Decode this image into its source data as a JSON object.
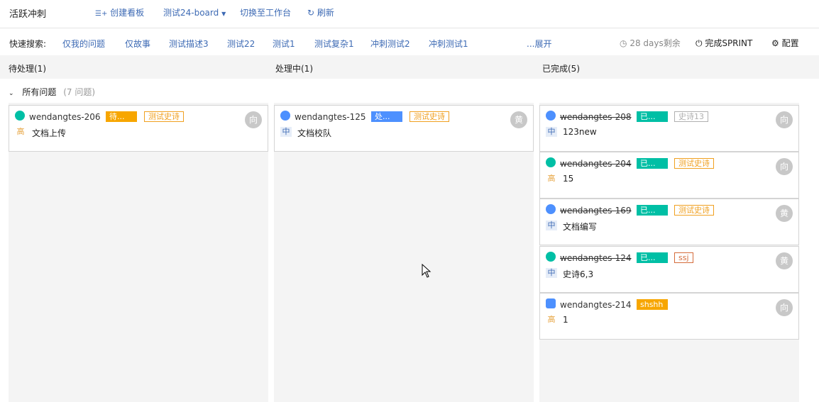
{
  "topbar": {
    "title": "活跃冲刺",
    "create_board": "创建看板",
    "board_select": "测试24-board",
    "switch_workspace": "切换至工作台",
    "refresh": "刷新"
  },
  "quick_search": {
    "label": "快速搜索:",
    "items": [
      "仅我的问题",
      "仅故事",
      "测试描述3",
      "测试22",
      "测试1",
      "测试复杂1",
      "冲刺测试2",
      "冲刺测试1",
      "...展开"
    ],
    "days_left": "28 days剩余",
    "complete_sprint": "完成SPRINT",
    "settings": "配置"
  },
  "columns": [
    {
      "header": "待处理(1)"
    },
    {
      "header": "处理中(1)"
    },
    {
      "header": "已完成(5)"
    }
  ],
  "swimlane": {
    "title": "所有问题",
    "count": "(7 问题)"
  },
  "cards": {
    "todo": [
      {
        "key": "wendangtes-206",
        "status": "待...",
        "tag": "测试史诗",
        "priority": "高",
        "summary": "文档上传",
        "avatar": "向"
      }
    ],
    "inprogress": [
      {
        "key": "wendangtes-125",
        "status": "处...",
        "tag": "测试史诗",
        "priority": "中",
        "summary": "文档校队",
        "avatar": "黄"
      }
    ],
    "done": [
      {
        "key": "wendangtes-208",
        "status": "已...",
        "tag": "史诗13",
        "priority": "中",
        "summary": "123new",
        "avatar": "向"
      },
      {
        "key": "wendangtes-204",
        "status": "已...",
        "tag": "测试史诗",
        "priority": "高",
        "summary": "15",
        "avatar": "向"
      },
      {
        "key": "wendangtes-169",
        "status": "已...",
        "tag": "测试史诗",
        "priority": "中",
        "summary": "文档编写",
        "avatar": "黄"
      },
      {
        "key": "wendangtes-124",
        "status": "已...",
        "tag": "ssj",
        "priority": "中",
        "summary": "史诗6,3",
        "avatar": "黄"
      },
      {
        "key": "wendangtes-214",
        "status": "shshh",
        "tag": "",
        "priority": "高",
        "summary": "1",
        "avatar": "向"
      }
    ]
  },
  "colors": {
    "link": "#3d6ab4",
    "todo_status": "#f7a600",
    "inprogress_status": "#4d90fe",
    "done_status": "#00bfa5",
    "epic_orange": "#f0a020",
    "epic_gray": "#b0b0b0",
    "epic_red": "#d46b3a",
    "story_icon": "#00bfa5",
    "task_icon": "#4d90fe"
  }
}
